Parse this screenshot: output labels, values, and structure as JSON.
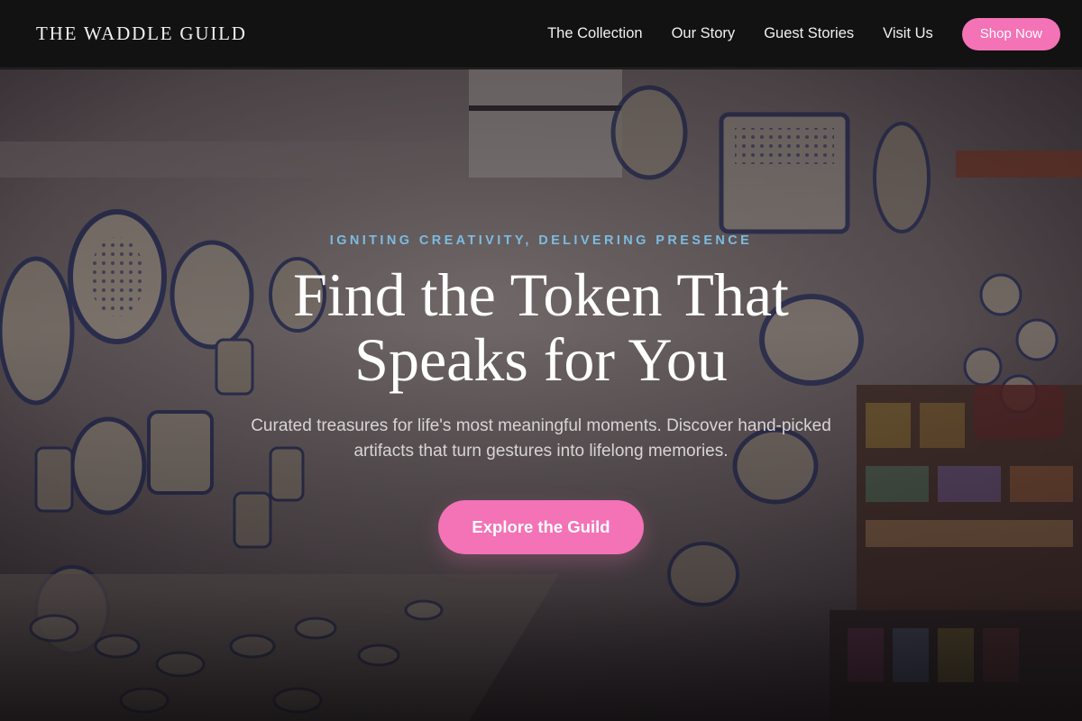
{
  "header": {
    "logo": "THE WADDLE GUILD",
    "nav": [
      {
        "label": "The Collection"
      },
      {
        "label": "Our Story"
      },
      {
        "label": "Guest Stories"
      },
      {
        "label": "Visit Us"
      }
    ],
    "cta_label": "Shop Now"
  },
  "hero": {
    "eyebrow": "IGNITING CREATIVITY, DELIVERING PRESENCE",
    "headline": "Find the Token That Speaks for You",
    "subtext": "Curated treasures for life's most meaningful moments. Discover hand-picked artifacts that turn gestures into lifelong memories.",
    "cta_label": "Explore the Guild",
    "background_image": "pottery-shop-photo"
  },
  "colors": {
    "accent": "#f472b6",
    "eyebrow": "#7dbbe0",
    "header_bg": "#121212"
  }
}
